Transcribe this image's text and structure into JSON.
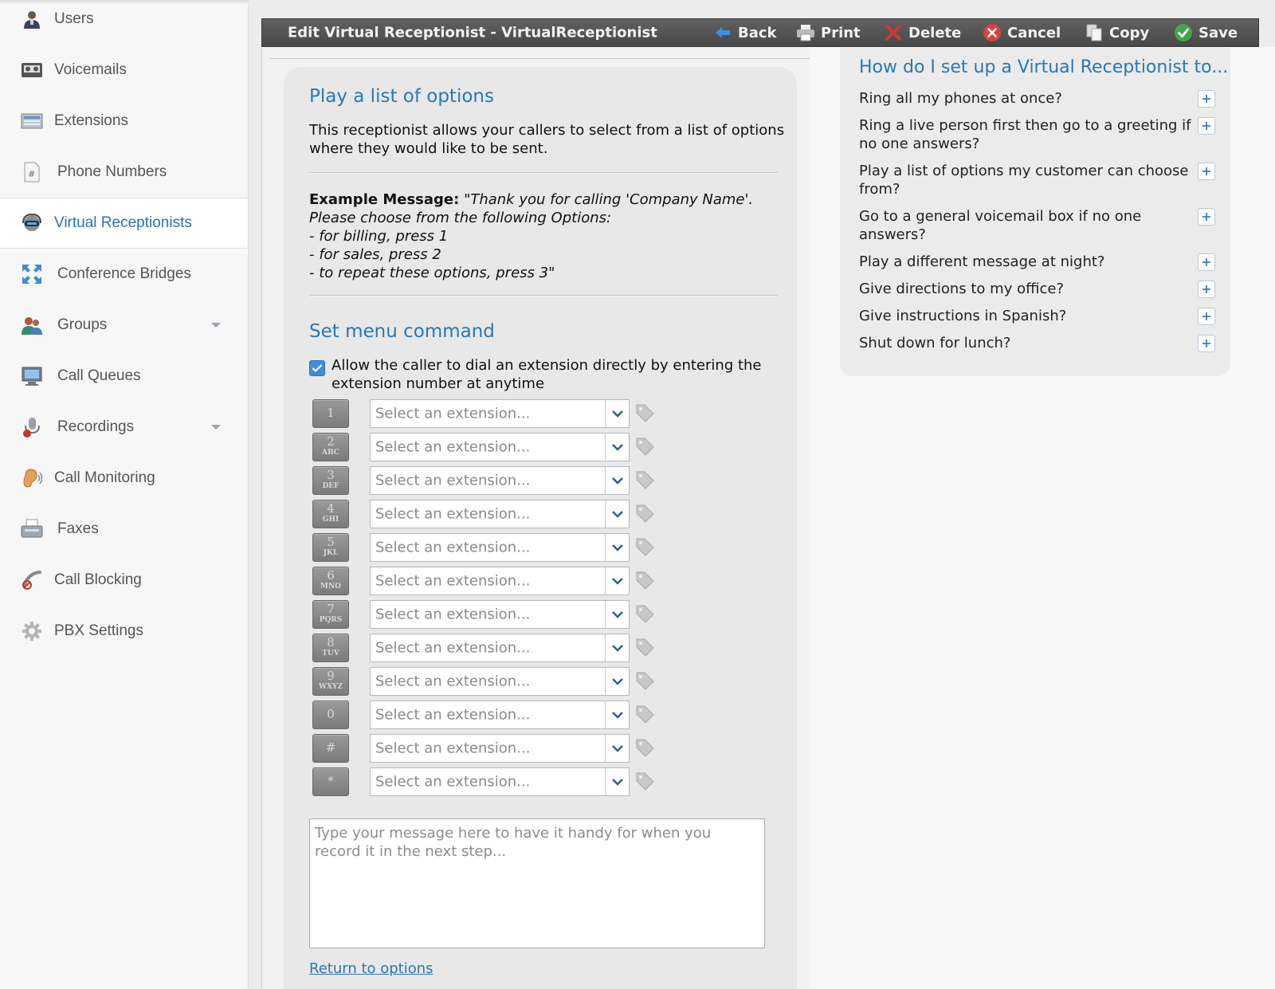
{
  "sidebar": {
    "items": [
      {
        "label": "Users",
        "icon": "user-icon"
      },
      {
        "label": "Voicemails",
        "icon": "voicemail-icon"
      },
      {
        "label": "Extensions",
        "icon": "extensions-icon"
      },
      {
        "label": "Phone Numbers",
        "icon": "phone-numbers-icon"
      },
      {
        "label": "Virtual Receptionists",
        "icon": "receptionist-icon",
        "active": true
      },
      {
        "label": "Conference Bridges",
        "icon": "conference-icon"
      },
      {
        "label": "Groups",
        "icon": "groups-icon",
        "has_caret": true
      },
      {
        "label": "Call Queues",
        "icon": "call-queues-icon"
      },
      {
        "label": "Recordings",
        "icon": "recordings-icon",
        "has_caret": true
      },
      {
        "label": "Call Monitoring",
        "icon": "call-monitoring-icon"
      },
      {
        "label": "Faxes",
        "icon": "fax-icon"
      },
      {
        "label": "Call Blocking",
        "icon": "call-blocking-icon"
      },
      {
        "label": "PBX Settings",
        "icon": "gear-icon"
      }
    ]
  },
  "toolbar": {
    "title": "Edit Virtual Receptionist - VirtualReceptionist",
    "back_label": "Back",
    "print_label": "Print",
    "delete_label": "Delete",
    "cancel_label": "Cancel",
    "copy_label": "Copy",
    "save_label": "Save"
  },
  "main": {
    "heading": "Play a list of options",
    "description": "This receptionist allows your callers to select from a list of options where they would like to be sent.",
    "example_label": "Example Message:",
    "example_lines": [
      "\"Thank you for calling 'Company Name'. Please choose from the following Options:",
      "- for billing, press 1",
      "- for sales, press 2",
      "- to repeat these options, press 3\""
    ],
    "menu_heading": "Set menu command",
    "checkbox_label": "Allow the caller to dial an extension directly by entering the extension number at anytime",
    "checkbox_checked": true,
    "options": [
      {
        "key": "1",
        "letters": "",
        "placeholder": "Select an extension..."
      },
      {
        "key": "2",
        "letters": "ABC",
        "placeholder": "Select an extension..."
      },
      {
        "key": "3",
        "letters": "DEF",
        "placeholder": "Select an extension..."
      },
      {
        "key": "4",
        "letters": "GHI",
        "placeholder": "Select an extension..."
      },
      {
        "key": "5",
        "letters": "JKL",
        "placeholder": "Select an extension..."
      },
      {
        "key": "6",
        "letters": "MNO",
        "placeholder": "Select an extension..."
      },
      {
        "key": "7",
        "letters": "PQRS",
        "placeholder": "Select an extension..."
      },
      {
        "key": "8",
        "letters": "TUV",
        "placeholder": "Select an extension..."
      },
      {
        "key": "9",
        "letters": "WXYZ",
        "placeholder": "Select an extension..."
      },
      {
        "key": "0",
        "letters": "",
        "placeholder": "Select an extension..."
      },
      {
        "key": "#",
        "letters": "",
        "placeholder": "Select an extension..."
      },
      {
        "key": "*",
        "letters": "",
        "placeholder": "Select an extension..."
      }
    ],
    "message_placeholder": "Type your message here to have it handy for when you record it in the next step...",
    "return_link": "Return to options"
  },
  "help": {
    "title": "How do I set up a Virtual Receptionist to...",
    "questions": [
      "Ring all my phones at once?",
      "Ring a live person first then go to a greeting if no one answers?",
      "Play a list of options my customer can choose from?",
      "Go to a general voicemail box if no one answers?",
      "Play a different message at night?",
      "Give directions to my office?",
      "Give instructions in Spanish?",
      "Shut down for lunch?"
    ]
  },
  "colors": {
    "accent": "#2878b8",
    "toolbar": "#545454",
    "checkbox": "#3f8fd6"
  }
}
